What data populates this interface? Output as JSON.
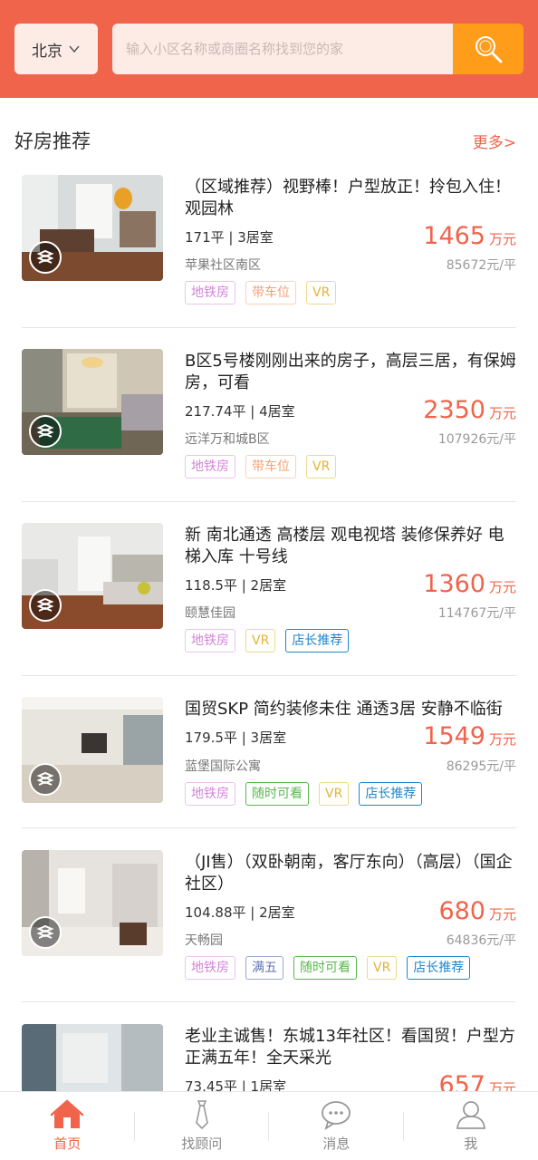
{
  "header": {
    "city": "北京",
    "search_placeholder": "输入小区名称或商圈名称找到您的家"
  },
  "section": {
    "title": "好房推荐",
    "more_label": "更多>"
  },
  "listings": [
    {
      "title": "（区域推荐）视野棒！户型放正！拎包入住！观园林",
      "meta": "171平 | 3居室",
      "community": "苹果社区南区",
      "price": "1465",
      "price_unit": "万元",
      "unit_price": "85672元/平",
      "tags": [
        {
          "text": "地铁房",
          "kind": "subway"
        },
        {
          "text": "带车位",
          "kind": "parking"
        },
        {
          "text": "VR",
          "kind": "vr"
        }
      ]
    },
    {
      "title": "B区5号楼刚刚出来的房子，高层三居，有保姆房，可看",
      "meta": "217.74平 | 4居室",
      "community": "远洋万和城B区",
      "price": "2350",
      "price_unit": "万元",
      "unit_price": "107926元/平",
      "tags": [
        {
          "text": "地铁房",
          "kind": "subway"
        },
        {
          "text": "带车位",
          "kind": "parking"
        },
        {
          "text": "VR",
          "kind": "vr"
        }
      ]
    },
    {
      "title": "新 南北通透 高楼层 观电视塔 装修保养好 电梯入库 十号线",
      "meta": "118.5平 | 2居室",
      "community": "颐慧佳园",
      "price": "1360",
      "price_unit": "万元",
      "unit_price": "114767元/平",
      "tags": [
        {
          "text": "地铁房",
          "kind": "subway"
        },
        {
          "text": "VR",
          "kind": "vr"
        },
        {
          "text": "店长推荐",
          "kind": "manager"
        }
      ]
    },
    {
      "title": "国贸SKP 简约装修未住 通透3居 安静不临街",
      "meta": "179.5平 | 3居室",
      "community": "蓝堡国际公寓",
      "price": "1549",
      "price_unit": "万元",
      "unit_price": "86295元/平",
      "tags": [
        {
          "text": "地铁房",
          "kind": "subway"
        },
        {
          "text": "随时可看",
          "kind": "anytime"
        },
        {
          "text": "VR",
          "kind": "vr"
        },
        {
          "text": "店长推荐",
          "kind": "manager"
        }
      ]
    },
    {
      "title": "（JI售）（双卧朝南，客厅东向）（高层）（国企社区）",
      "meta": "104.88平 | 2居室",
      "community": "天畅园",
      "price": "680",
      "price_unit": "万元",
      "unit_price": "64836元/平",
      "tags": [
        {
          "text": "地铁房",
          "kind": "subway"
        },
        {
          "text": "满五",
          "kind": "fiveyear"
        },
        {
          "text": "随时可看",
          "kind": "anytime"
        },
        {
          "text": "VR",
          "kind": "vr"
        },
        {
          "text": "店长推荐",
          "kind": "manager"
        }
      ]
    },
    {
      "title": "老业主诚售！东城13年社区！看国贸！户型方正满五年！全天采光",
      "meta": "73.45平 | 1居室",
      "community": "",
      "price": "657",
      "price_unit": "万元",
      "unit_price": "",
      "tags": []
    }
  ],
  "tabbar": [
    {
      "label": "首页",
      "icon": "home-icon",
      "active": true
    },
    {
      "label": "找顾问",
      "icon": "tie-icon",
      "active": false
    },
    {
      "label": "消息",
      "icon": "chat-icon",
      "active": false
    },
    {
      "label": "我",
      "icon": "person-icon",
      "active": false
    }
  ],
  "colors": {
    "brand": "#f0644b",
    "search_button": "#ff9d1a"
  }
}
